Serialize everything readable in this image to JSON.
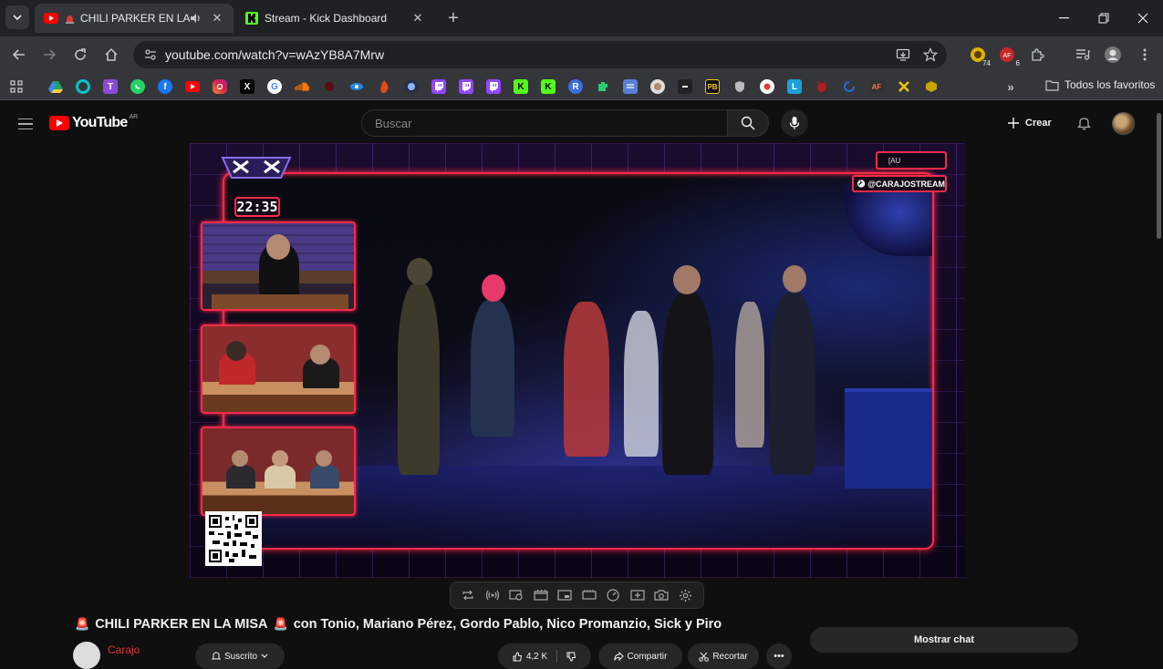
{
  "browser": {
    "tabs": [
      {
        "title": "CHILI PARKER EN LA MISA",
        "active": true,
        "favicon": "youtube-icon"
      },
      {
        "title": "Stream - Kick Dashboard",
        "active": false,
        "favicon": "kick-icon"
      }
    ],
    "url": "youtube.com/watch?v=wAzYB8A7Mrw",
    "extension_badges": {
      "first": "74",
      "second": "6"
    },
    "bookmarks_all_label": "Todos los favoritos"
  },
  "youtube": {
    "region": "AR",
    "logo_text": "YouTube",
    "search_placeholder": "Buscar",
    "create_label": "Crear"
  },
  "video": {
    "overlay_clock": "22:35",
    "overlay_handle": "@CARAJOSTREAM",
    "overlay_top_tag": "[AU",
    "title_emoji_left": "🚨",
    "title_main": "CHILI PARKER EN LA MISA",
    "title_emoji_right": "🚨",
    "title_rest": "con Tonio, Mariano Pérez, Gordo Pablo, Nico Promanzio, Sick y Piro",
    "channel_name": "Carajo",
    "subscribe_label": "Suscrito",
    "likes": "4,2 K",
    "share_label": "Compartir",
    "clip_label": "Recortar"
  },
  "chat": {
    "show_label": "Mostrar chat"
  },
  "colors": {
    "accent_red": "#ff0000",
    "neon_frame": "#ff2a4a",
    "bg": "#0f0f0f",
    "kick_green": "#53fc18"
  }
}
